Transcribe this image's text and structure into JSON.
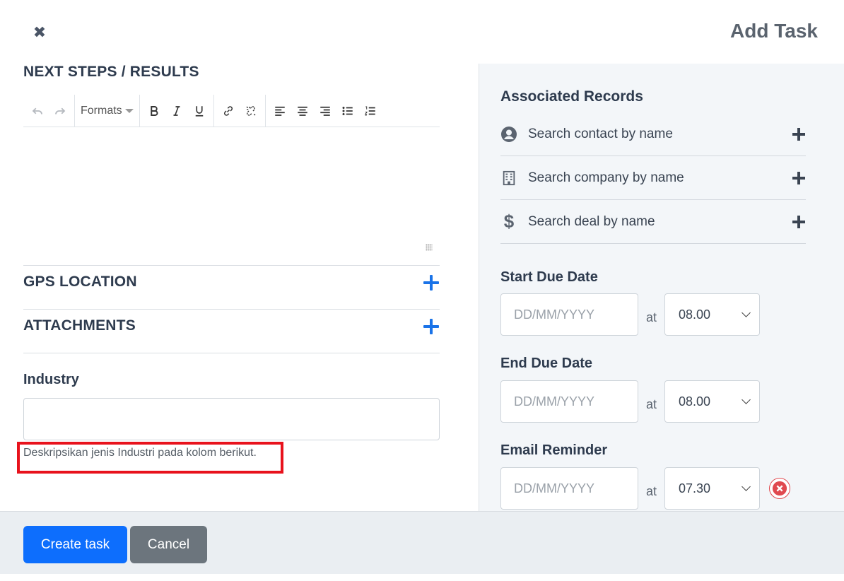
{
  "modal": {
    "title": "Add Task",
    "close_icon": "close-icon"
  },
  "left": {
    "next_steps_title": "NEXT STEPS / RESULTS",
    "toolbar": {
      "formats_label": "Formats",
      "icons": [
        "undo-icon",
        "redo-icon",
        "bold-icon",
        "italic-icon",
        "underline-icon",
        "link-icon",
        "unlink-icon",
        "align-left-icon",
        "align-center-icon",
        "align-right-icon",
        "bullet-list-icon",
        "numbered-list-icon"
      ]
    },
    "gps_title": "GPS LOCATION",
    "attachments_title": "ATTACHMENTS",
    "industry_label": "Industry",
    "industry_value": "",
    "industry_help": "Deskripsikan jenis Industri pada kolom berikut."
  },
  "right": {
    "associated_title": "Associated Records",
    "records": [
      {
        "icon": "user-circle-icon",
        "placeholder": "Search contact by name"
      },
      {
        "icon": "building-icon",
        "placeholder": "Search company by name"
      },
      {
        "icon": "dollar-icon",
        "placeholder": "Search deal by name"
      }
    ],
    "at_text": "at",
    "start_due": {
      "label": "Start Due Date",
      "placeholder": "DD/MM/YYYY",
      "time": "08.00"
    },
    "end_due": {
      "label": "End Due Date",
      "placeholder": "DD/MM/YYYY",
      "time": "08.00"
    },
    "email_reminder": {
      "label": "Email Reminder",
      "placeholder": "DD/MM/YYYY",
      "time": "07.30"
    }
  },
  "footer": {
    "create_label": "Create task",
    "cancel_label": "Cancel"
  },
  "colors": {
    "primary": "#0d6efd",
    "secondary": "#6c757d",
    "highlight": "#e8121c",
    "plus_blue": "#1a73e8"
  }
}
